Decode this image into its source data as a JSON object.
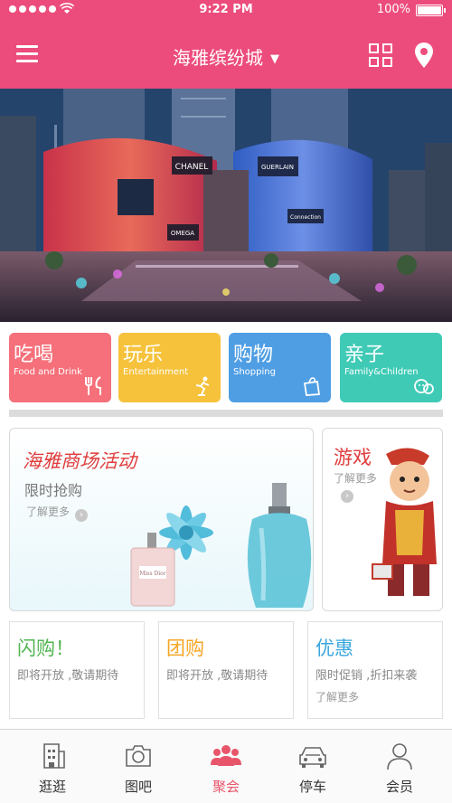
{
  "status_bar": {
    "time": "9:22 PM",
    "battery": "100%"
  },
  "header": {
    "title": "海雅缤纷城",
    "caret": "▼"
  },
  "banner": {
    "signs": [
      "CHANEL",
      "OMEGA",
      "GUERLAIN",
      "Connection"
    ]
  },
  "categories": [
    {
      "cn": "吃喝",
      "en": "Food and Drink",
      "color": "#f5707a",
      "icon": "fork-knife-icon"
    },
    {
      "cn": "玩乐",
      "en": "Entertainment",
      "color": "#f6c23b",
      "icon": "skater-icon"
    },
    {
      "cn": "购物",
      "en": "Shopping",
      "color": "#4f9ee4",
      "icon": "shopping-bag-icon"
    },
    {
      "cn": "亲子",
      "en": "Family&Children",
      "color": "#3fcab6",
      "icon": "family-icon"
    }
  ],
  "promo_main": {
    "title": "海雅商场活动",
    "subtitle": "限时抢购",
    "more": "了解更多",
    "product_label": "Miss Dior"
  },
  "promo_game": {
    "title": "游戏",
    "more": "了解更多"
  },
  "deals": [
    {
      "title": "闪购！",
      "desc": "即将开放 ,敬请期待",
      "more": "",
      "color": "#52b552"
    },
    {
      "title": "团购",
      "desc": "即将开放 ,敬请期待",
      "more": "",
      "color": "#f5a623"
    },
    {
      "title": "优惠",
      "desc": "限时促销 ,折扣来袭",
      "more": "了解更多",
      "color": "#3aa6dd"
    }
  ],
  "tabs": [
    {
      "label": "逛逛",
      "icon": "building-icon"
    },
    {
      "label": "图吧",
      "icon": "camera-icon"
    },
    {
      "label": "聚会",
      "icon": "people-icon",
      "active": true
    },
    {
      "label": "停车",
      "icon": "car-icon"
    },
    {
      "label": "会员",
      "icon": "person-icon"
    }
  ],
  "colors": {
    "brand": "#ec4c7c",
    "active_tab": "#e8556a"
  }
}
